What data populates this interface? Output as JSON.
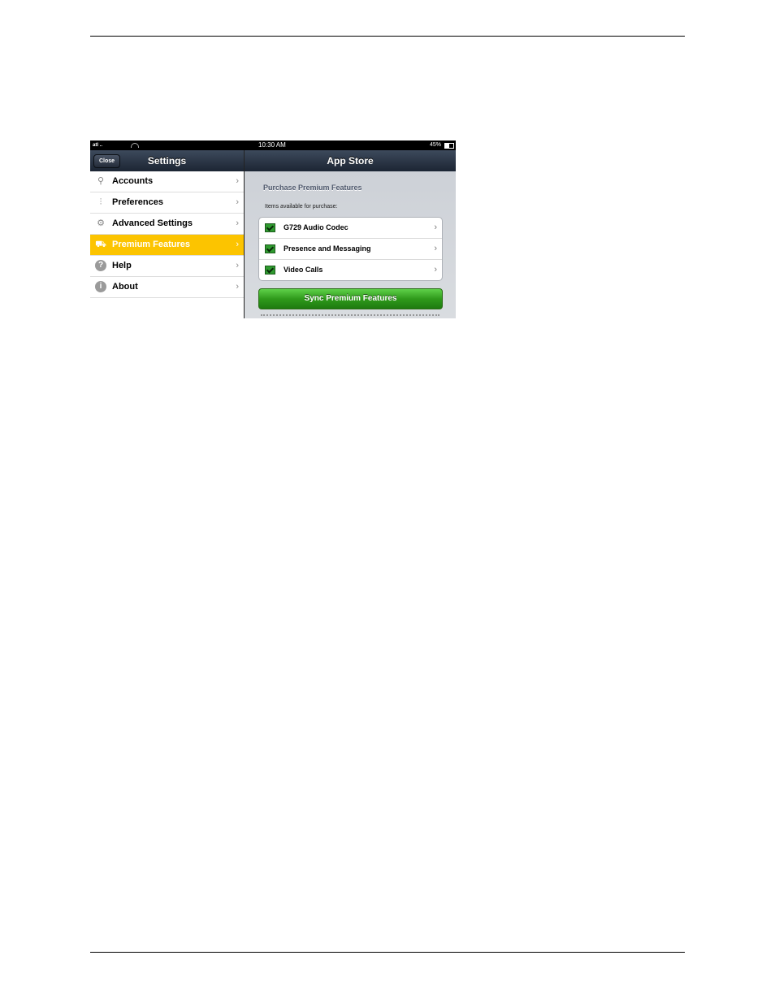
{
  "status_bar": {
    "signal": "atl ..",
    "time": "10:30 AM",
    "battery": "45%",
    "battery_level": 0.45
  },
  "settings_nav": {
    "title": "Settings",
    "close_label": "Close"
  },
  "app_store_nav": {
    "title": "App Store"
  },
  "sidebar": {
    "items": [
      {
        "label": "Accounts",
        "icon": "accounts-icon"
      },
      {
        "label": "Preferences",
        "icon": "preferences-icon"
      },
      {
        "label": "Advanced Settings",
        "icon": "gear-icon"
      },
      {
        "label": "Premium Features",
        "icon": "cart-icon",
        "selected": true
      },
      {
        "label": "Help",
        "icon": "help-icon"
      },
      {
        "label": "About",
        "icon": "info-icon"
      }
    ]
  },
  "main": {
    "section_title": "Purchase Premium Features",
    "available_label": "Items available for purchase:",
    "items": [
      {
        "label": "G729 Audio Codec",
        "checked": true
      },
      {
        "label": "Presence and Messaging",
        "checked": true
      },
      {
        "label": "Video Calls",
        "checked": true
      }
    ],
    "sync_button": "Sync Premium Features"
  },
  "colors": {
    "accent": "#fcc400",
    "sync_green": "#2f9a1b",
    "navbar": "#1c2533"
  }
}
